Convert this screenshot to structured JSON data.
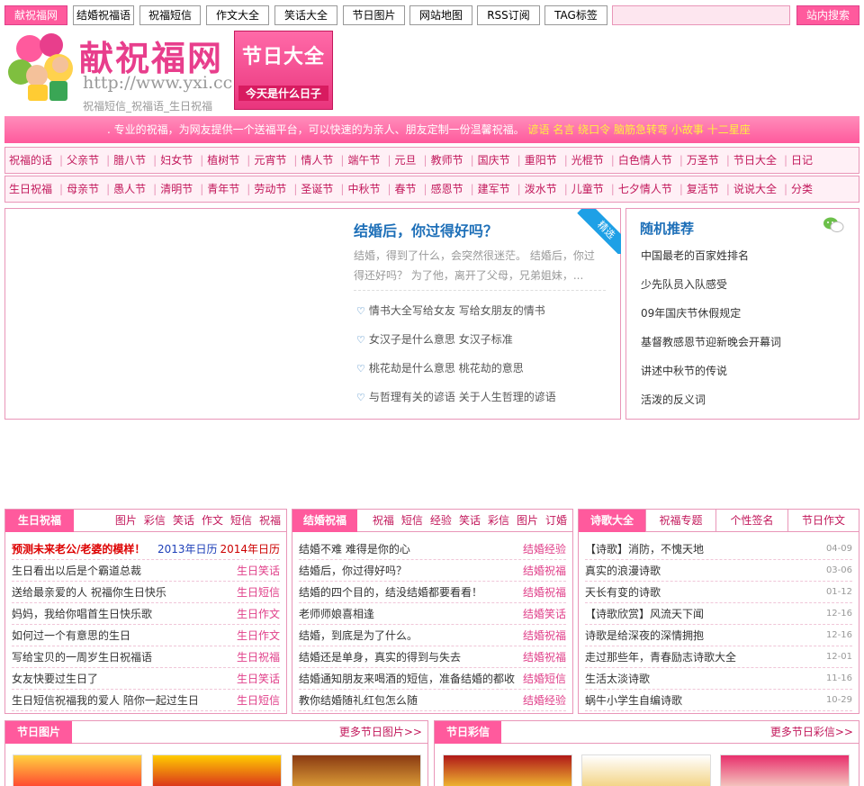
{
  "nav": {
    "items": [
      "献祝福网",
      "结婚祝福语",
      "祝福短信",
      "作文大全",
      "笑话大全",
      "节日图片",
      "网站地图",
      "RSS订阅",
      "TAG标签"
    ],
    "search_button": "站内搜索"
  },
  "logo": {
    "title": "献祝福网",
    "url": "http://www.yxi.cc",
    "subtitle": "祝福短信_祝福语_生日祝福"
  },
  "banner": {
    "title": "节日大全",
    "subtitle": "今天是什么日子"
  },
  "intro": {
    "text": ". 专业的祝福，为网友提供一个送福平台，可以快速的为亲人、朋友定制一份温馨祝福。",
    "links": [
      "谚语",
      "名言",
      "绕口令",
      "脑筋急转弯",
      "小故事",
      "十二星座"
    ]
  },
  "catrow1": [
    "祝福的话",
    "父亲节",
    "腊八节",
    "妇女节",
    "植树节",
    "元宵节",
    "情人节",
    "端午节",
    "元旦",
    "教师节",
    "国庆节",
    "重阳节",
    "光棍节",
    "白色情人节",
    "万圣节",
    "节日大全",
    "日记"
  ],
  "catrow2": [
    "生日祝福",
    "母亲节",
    "愚人节",
    "清明节",
    "青年节",
    "劳动节",
    "圣诞节",
    "中秋节",
    "春节",
    "感恩节",
    "建军节",
    "泼水节",
    "儿童节",
    "七夕情人节",
    "复活节",
    "说说大全",
    "分类"
  ],
  "featured": {
    "badge": "精选",
    "title": "结婚后，你过得好吗？",
    "desc": "结婚，得到了什么，会突然很迷茫。 结婚后，你过得还好吗？ 为了他，离开了父母，兄弟姐妹，...",
    "links": [
      "情书大全写给女友 写给女朋友的情书",
      "女汉子是什么意思 女汉子标准",
      "桃花劫是什么意思 桃花劫的意思",
      "与哲理有关的谚语 关于人生哲理的谚语"
    ]
  },
  "random": {
    "title": "随机推荐",
    "items": [
      "中国最老的百家姓排名",
      "少先队员入队感受",
      "09年国庆节休假规定",
      "基督教感恩节迎新晚会开幕词",
      "讲述中秋节的传说",
      "活泼的反义词"
    ]
  },
  "birthday": {
    "tab": "生日祝福",
    "links": [
      "图片",
      "彩信",
      "笑话",
      "作文",
      "短信",
      "祝福"
    ],
    "highlight": {
      "left": "预测未来老公/老婆的模样！",
      "mid": "2013年日历",
      "right": "2014年日历"
    },
    "rows": [
      {
        "t": "生日看出以后是个霸道总裁",
        "tag": "生日笑话"
      },
      {
        "t": "送给最亲爱的人 祝福你生日快乐",
        "tag": "生日短信"
      },
      {
        "t": "妈妈，我给你唱首生日快乐歌",
        "tag": "生日作文"
      },
      {
        "t": "如何过一个有意思的生日",
        "tag": "生日作文"
      },
      {
        "t": "写给宝贝的一周岁生日祝福语",
        "tag": "生日祝福"
      },
      {
        "t": "女友快要过生日了",
        "tag": "生日笑话"
      },
      {
        "t": "生日短信祝福我的爱人 陪你一起过生日",
        "tag": "生日短信"
      }
    ]
  },
  "wedding": {
    "tab": "结婚祝福",
    "links": [
      "祝福",
      "短信",
      "经验",
      "笑话",
      "彩信",
      "图片",
      "订婚"
    ],
    "rows": [
      {
        "t": "结婚不难 难得是你的心",
        "tag": "结婚经验"
      },
      {
        "t": "结婚后，你过得好吗？",
        "tag": "结婚祝福"
      },
      {
        "t": "结婚的四个目的，结没结婚都要看看！",
        "tag": "结婚祝福"
      },
      {
        "t": "老师师娘喜相逢",
        "tag": "结婚笑话"
      },
      {
        "t": "结婚，到底是为了什么。",
        "tag": "结婚祝福"
      },
      {
        "t": "结婚还是单身，真实的得到与失去",
        "tag": "结婚祝福"
      },
      {
        "t": "结婚通知朋友来喝酒的短信，准备结婚的都收",
        "tag": "结婚短信"
      },
      {
        "t": "教你结婚随礼红包怎么随",
        "tag": "结婚经验"
      }
    ]
  },
  "poetry": {
    "tabs": [
      "诗歌大全",
      "祝福专题",
      "个性签名",
      "节日作文"
    ],
    "rows": [
      {
        "t": "【诗歌】消防，不愧天地",
        "d": "04-09"
      },
      {
        "t": "真实的浪漫诗歌",
        "d": "03-06"
      },
      {
        "t": "天长有变的诗歌",
        "d": "01-12"
      },
      {
        "t": "【诗歌欣赏】风流天下闻",
        "d": "12-16"
      },
      {
        "t": "诗歌是给深夜的深情拥抱",
        "d": "12-16"
      },
      {
        "t": "走过那些年，青春励志诗歌大全",
        "d": "12-01"
      },
      {
        "t": "生活太淡诗歌",
        "d": "11-16"
      },
      {
        "t": "蜗牛小学生自编诗歌",
        "d": "10-29"
      }
    ]
  },
  "holiday_pics": {
    "tab": "节日图片",
    "more": "更多节日图片>>"
  },
  "holiday_mms": {
    "tab": "节日彩信",
    "more": "更多节日彩信>>"
  },
  "colors": {
    "pink": "#ff5a9d",
    "border": "#e996b8",
    "blue": "#1d6fb8"
  }
}
